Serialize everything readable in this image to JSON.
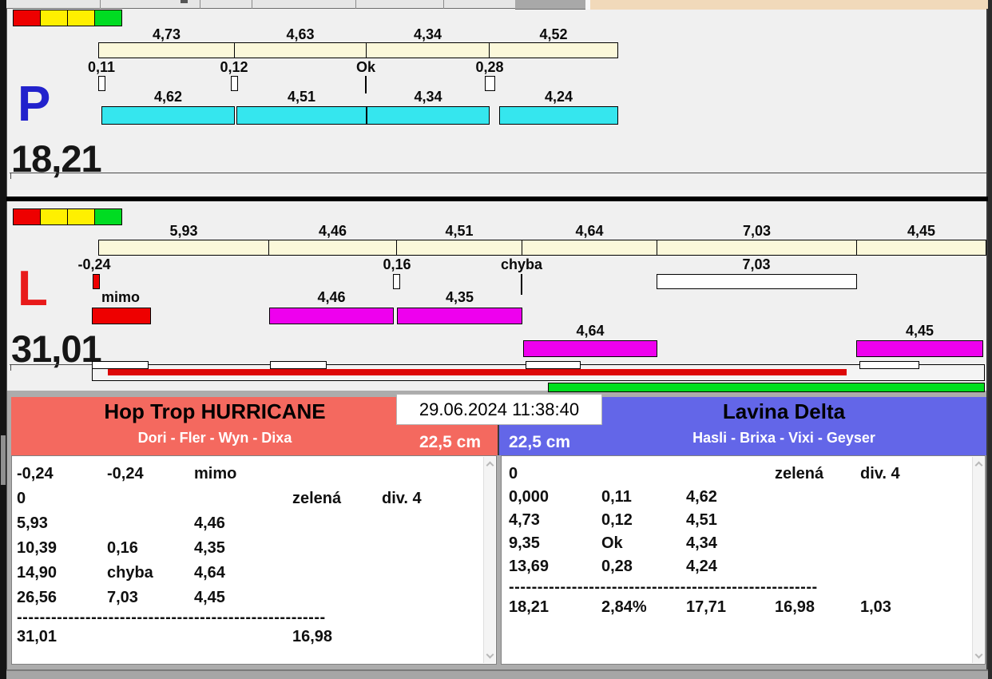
{
  "panels": {
    "p": {
      "letter": "P",
      "total": "18,21",
      "split_times": [
        "4,73",
        "4,63",
        "4,34",
        "4,52"
      ],
      "exchange_times": [
        "0,11",
        "0,12",
        "Ok",
        "0,28"
      ],
      "run_times": [
        "4,62",
        "4,51",
        "4,34",
        "4,24"
      ]
    },
    "l": {
      "letter": "L",
      "total": "31,01",
      "split_times": [
        "5,93",
        "4,46",
        "4,51",
        "4,64",
        "7,03",
        "4,45"
      ],
      "exchange_times": [
        "-0,24",
        "0,16",
        "chyba",
        "7,03"
      ],
      "fault_label": "mimo",
      "run_times_row1": [
        "4,46",
        "4,35"
      ],
      "run_times_row2": [
        "4,64",
        "4,45"
      ]
    }
  },
  "datetime": "29.06.2024 11:38:40",
  "teams": {
    "left": {
      "name": "Hop Trop HURRICANE",
      "dogs": "Dori - Fler - Wyn - Dixa",
      "jump_height": "22,5 cm",
      "rows": [
        [
          "-0,24",
          "-0,24",
          "mimo",
          "",
          ""
        ],
        [
          "0",
          "",
          "",
          "zelená",
          "div. 4"
        ],
        [
          "5,93",
          "",
          "4,46",
          "",
          ""
        ],
        [
          "10,39",
          "0,16",
          "4,35",
          "",
          ""
        ],
        [
          "14,90",
          "chyba",
          "4,64",
          "",
          ""
        ],
        [
          "26,56",
          "7,03",
          "4,45",
          "",
          ""
        ]
      ],
      "separator": "------------------------------------------------------",
      "total_row": [
        "31,01",
        "",
        "",
        "16,98",
        ""
      ]
    },
    "right": {
      "name": "Lavina Delta",
      "dogs": "Hasli - Brixa - Vixi - Geyser",
      "jump_height": "22,5 cm",
      "rows": [
        [
          "0",
          "",
          "",
          "zelená",
          "div. 4"
        ],
        [
          "0,000",
          "0,11",
          "4,62",
          "",
          ""
        ],
        [
          "4,73",
          "0,12",
          "4,51",
          "",
          ""
        ],
        [
          "9,35",
          "Ok",
          "4,34",
          "",
          ""
        ],
        [
          "13,69",
          "0,28",
          "4,24",
          "",
          ""
        ]
      ],
      "separator": "------------------------------------------------------",
      "total_row": [
        "18,21",
        "2,84%",
        "17,71",
        "16,98",
        "1,03"
      ]
    }
  },
  "colors": {
    "traffic": [
      "#EE0000",
      "#FFF000",
      "#FFF000",
      "#00DC22"
    ],
    "split_bar": "#FBF8DA",
    "run_bar_p": "#35E6EE",
    "run_bar_l": "#EE00EE",
    "fault_bar": "#EE0000",
    "progress_red": "#DD0808",
    "progress_green": "#00DE1E",
    "team_left_accent": "#F4695F",
    "team_right_accent": "#6366E8",
    "letter_p": "#2222CC",
    "letter_l": "#E81A1A"
  }
}
